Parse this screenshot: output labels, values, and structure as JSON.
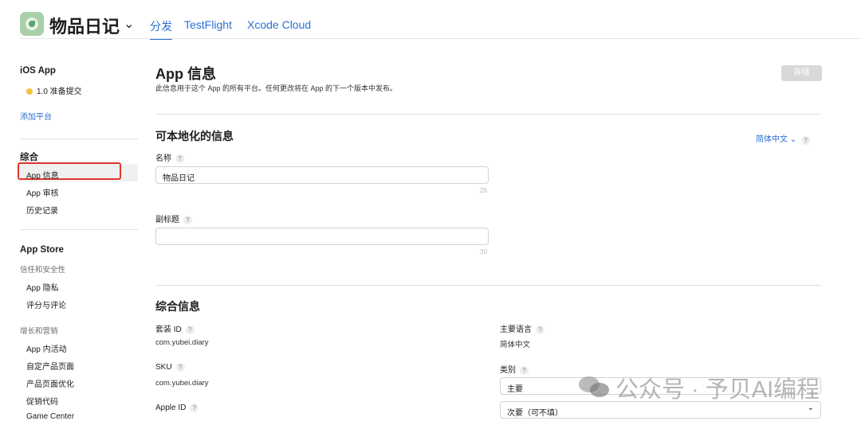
{
  "header": {
    "app_name": "物品日记",
    "tabs": [
      "分发",
      "TestFlight",
      "Xcode Cloud"
    ]
  },
  "sidebar": {
    "ios_app": "iOS App",
    "version": "1.0 准备提交",
    "add_platform": "添加平台",
    "general": "综合",
    "general_items": [
      "App 信息",
      "App 审核",
      "历史记录"
    ],
    "app_store": "App Store",
    "trust_group": "信任和安全性",
    "trust_items": [
      "App 隐私",
      "评分与评论"
    ],
    "growth_group": "增长和营销",
    "growth_items": [
      "App 内活动",
      "自定产品页面",
      "产品页面优化",
      "促销代码",
      "Game Center"
    ]
  },
  "main": {
    "title": "App 信息",
    "subtitle": "此信息用于这个 App 的所有平台。任何更改将在 App 的下一个版本中发布。",
    "save": "存储",
    "localizable": "可本地化的信息",
    "language": "简体中文 ⌄",
    "name_label": "名称",
    "name_value": "物品日记",
    "name_limit": "26",
    "subtitle_label": "副标题",
    "subtitle_value": "",
    "subtitle_limit": "30",
    "general_info": "综合信息",
    "bundle_label": "套装 ID",
    "bundle_value": "com.yubei.diary",
    "sku_label": "SKU",
    "sku_value": "com.yubei.diary",
    "appleid_label": "Apple ID",
    "primary_lang_label": "主要语言",
    "primary_lang_value": "简体中文",
    "category_label": "类别",
    "primary_cat": "主要",
    "secondary_cat": "次要（可不填）"
  },
  "watermark": "公众号 · 予贝AI编程"
}
